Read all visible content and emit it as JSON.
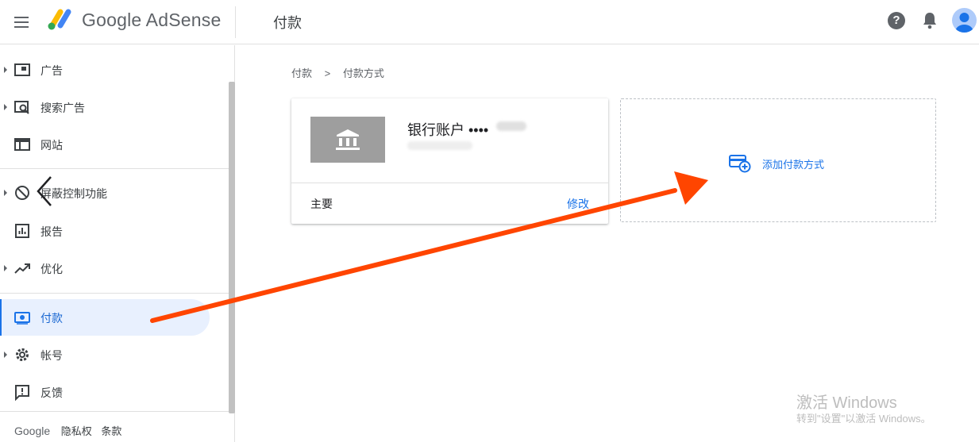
{
  "header": {
    "brand": "Google AdSense",
    "title": "付款"
  },
  "sidebar": {
    "items": [
      {
        "label": "广告"
      },
      {
        "label": "搜索广告"
      },
      {
        "label": "网站"
      },
      {
        "label": "屏蔽控制功能"
      },
      {
        "label": "报告"
      },
      {
        "label": "优化"
      },
      {
        "label": "付款"
      },
      {
        "label": "帐号"
      },
      {
        "label": "反馈"
      }
    ],
    "footer": {
      "brand": "Google",
      "privacy": "隐私权",
      "terms": "条款"
    }
  },
  "breadcrumb": {
    "root": "付款",
    "separator": ">",
    "current": "付款方式"
  },
  "payment_card": {
    "account_name": "银行账户 ••••",
    "primary_label": "主要",
    "edit_label": "修改"
  },
  "add_payment": {
    "label": "添加付款方式"
  },
  "watermark": {
    "line1": "激活 Windows",
    "line2": "转到\"设置\"以激活 Windows。"
  },
  "colors": {
    "accent": "#1a73e8",
    "arrow": "#ff4500",
    "active_bg": "#e8f0fe",
    "bank_tile": "#9e9e9e"
  }
}
